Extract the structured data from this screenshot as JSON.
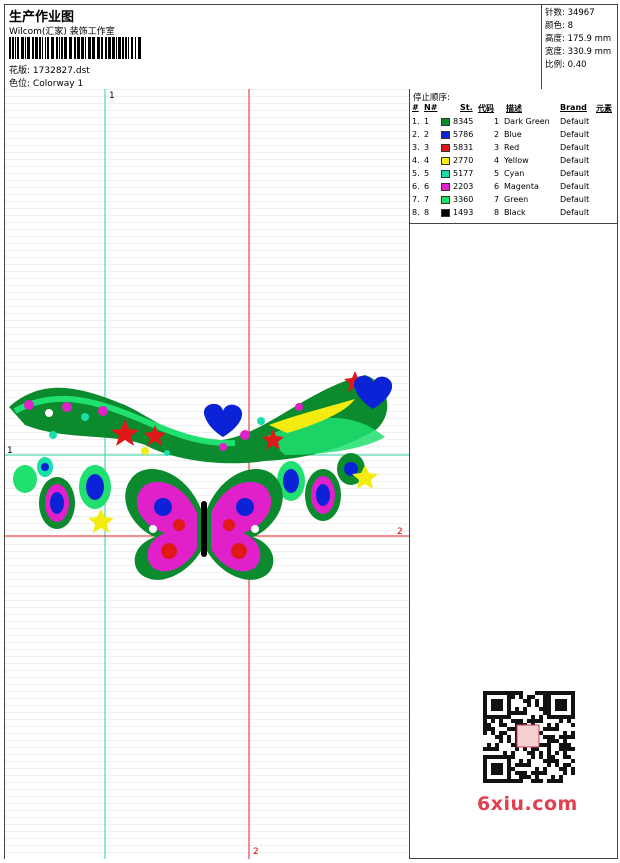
{
  "header": {
    "title": "生产作业图",
    "company": "Wilcom(汇家) 装饰工作室",
    "design_label": "花版:",
    "design_value": "1732827.dst",
    "colorway_label": "色位:",
    "colorway_value": "Colorway 1"
  },
  "stats": [
    {
      "label": "针数:",
      "value": "34967"
    },
    {
      "label": "颜色:",
      "value": "8"
    },
    {
      "label": "高度:",
      "value": "175.9 mm"
    },
    {
      "label": "宽度:",
      "value": "330.9 mm"
    },
    {
      "label": "比例:",
      "value": "0.40"
    }
  ],
  "stop_sequence": {
    "title": "停止顺序:",
    "columns": [
      "#",
      "N#",
      "St.",
      "代码",
      "描述",
      "Brand",
      "元素"
    ],
    "rows": [
      {
        "num": "1.",
        "n": "1",
        "stitches": "8345",
        "code": "1",
        "desc": "Dark Green",
        "brand": "Default",
        "color": "#0b8a2e"
      },
      {
        "num": "2.",
        "n": "2",
        "stitches": "5786",
        "code": "2",
        "desc": "Blue",
        "brand": "Default",
        "color": "#0b22d6"
      },
      {
        "num": "3.",
        "n": "3",
        "stitches": "5831",
        "code": "3",
        "desc": "Red",
        "brand": "Default",
        "color": "#e01818"
      },
      {
        "num": "4.",
        "n": "4",
        "stitches": "2770",
        "code": "4",
        "desc": "Yellow",
        "brand": "Default",
        "color": "#f4ec10"
      },
      {
        "num": "5.",
        "n": "5",
        "stitches": "5177",
        "code": "5",
        "desc": "Cyan",
        "brand": "Default",
        "color": "#18e0a8"
      },
      {
        "num": "6.",
        "n": "6",
        "stitches": "2203",
        "code": "6",
        "desc": "Magenta",
        "brand": "Default",
        "color": "#e020c8"
      },
      {
        "num": "7.",
        "n": "7",
        "stitches": "3360",
        "code": "7",
        "desc": "Green",
        "brand": "Default",
        "color": "#20e070"
      },
      {
        "num": "8.",
        "n": "8",
        "stitches": "1493",
        "code": "8",
        "desc": "Black",
        "brand": "Default",
        "color": "#000000"
      }
    ]
  },
  "guides": {
    "v1": "1",
    "h1": "1",
    "v2": "2",
    "h2": "2"
  },
  "watermark": {
    "site": "6xiu.com"
  }
}
